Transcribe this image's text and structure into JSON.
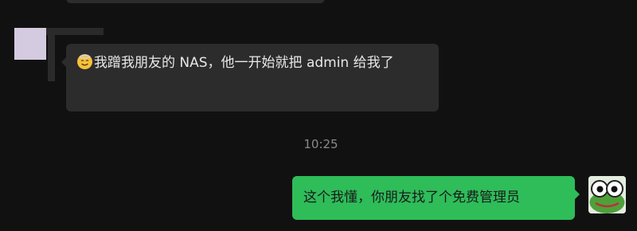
{
  "conversation": {
    "previous_bubble_visible": true,
    "incoming": {
      "emoji": "smiling-face-with-halo-icon",
      "text": "我蹭我朋友的 NAS，他一开始就把 admin 给我了"
    },
    "timestamp": "10:25",
    "outgoing": {
      "text": "这个我懂，你朋友找了个免费管理员"
    }
  },
  "colors": {
    "background": "#111111",
    "incoming_bubble": "#2c2c2c",
    "outgoing_bubble": "#2ebd59",
    "timestamp_text": "#8a8a8a"
  }
}
